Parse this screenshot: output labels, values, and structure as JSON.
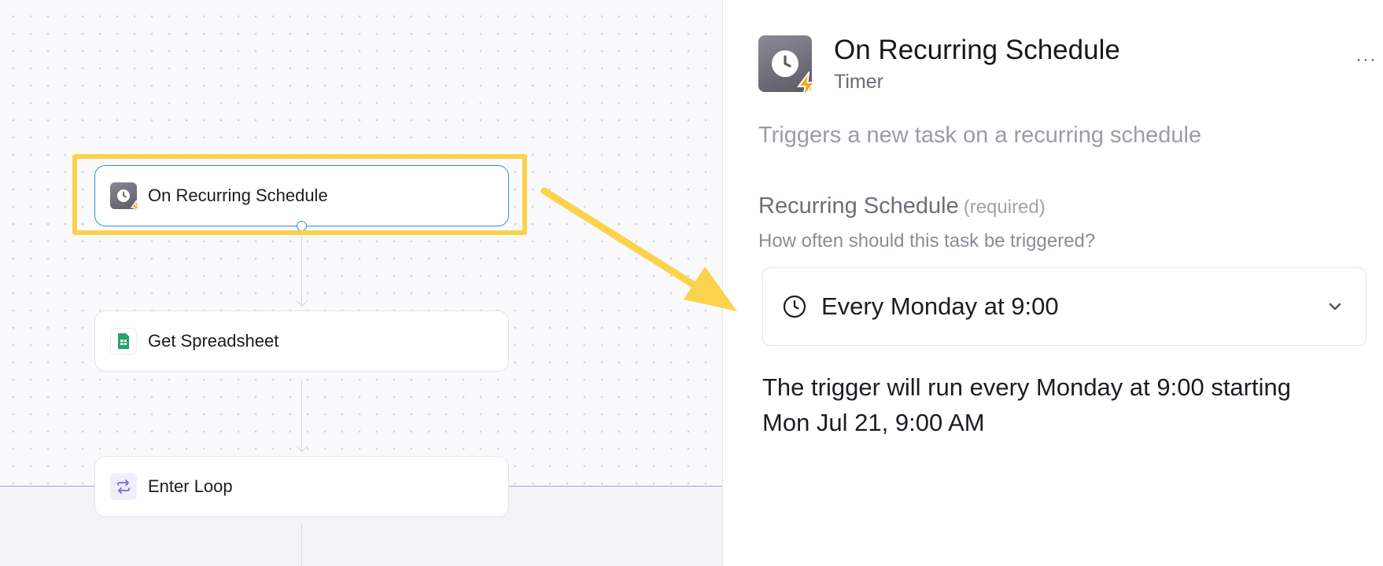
{
  "canvas": {
    "nodes": [
      {
        "label": "On Recurring Schedule",
        "icon": "timer-icon",
        "selected": true
      },
      {
        "label": "Get Spreadsheet",
        "icon": "spreadsheet-icon",
        "selected": false
      },
      {
        "label": "Enter Loop",
        "icon": "loop-icon",
        "selected": false
      }
    ]
  },
  "panel": {
    "title": "On Recurring Schedule",
    "subtitle": "Timer",
    "more_label": "···",
    "description": "Triggers a new task on a recurring schedule",
    "field": {
      "label": "Recurring Schedule",
      "required": "(required)",
      "help": "How often should this task be triggered?",
      "value": "Every Monday at 9:00"
    },
    "run_info": "The trigger will run every Monday at 9:00 starting Mon Jul 21, 9:00 AM"
  },
  "colors": {
    "highlight": "#fbd24b",
    "selected_border": "#2f8fe0",
    "bolt": "#f5a623",
    "loop_accent": "#7a6bd8",
    "sheet_green": "#23a566"
  }
}
